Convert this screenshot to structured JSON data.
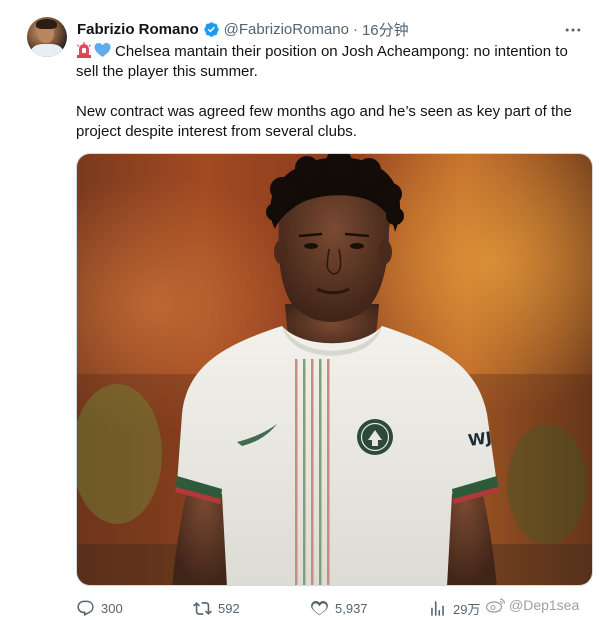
{
  "author": {
    "name": "Fabrizio Romano",
    "handle": "@FabrizioRomano",
    "separator": "·",
    "time": "16分钟"
  },
  "tweet": {
    "line1": "Chelsea mantain their position on Josh Acheampong: no intention to sell the player this summer.",
    "line2": "New contract was agreed few months ago and he’s seen as key part of the project despite interest from several clubs."
  },
  "actions": {
    "replies": "300",
    "retweets": "592",
    "likes": "5,937",
    "views": "29万"
  },
  "watermark": "@Dep1sea",
  "icons": {
    "verified": "verified-badge-icon",
    "more": "more-icon",
    "siren": "rotating-light-emoji",
    "heart": "blue-heart-emoji",
    "reply": "reply-icon",
    "retweet": "retweet-icon",
    "like": "like-icon",
    "views": "views-icon",
    "weibo": "weibo-icon"
  },
  "colors": {
    "text": "#0f1419",
    "secondary": "#536471",
    "verified": "#1d9bf0",
    "heart": "#5dadec"
  }
}
